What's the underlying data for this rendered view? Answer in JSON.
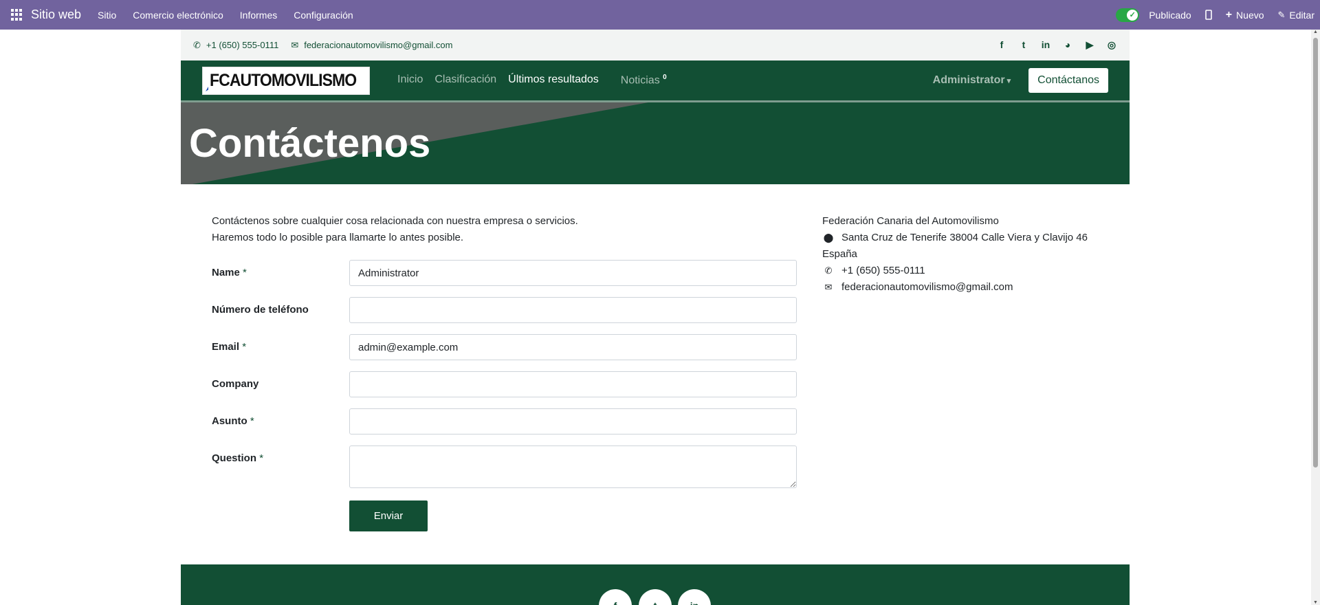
{
  "adminbar": {
    "brand": "Sitio web",
    "menu": [
      "Sitio",
      "Comercio electrónico",
      "Informes",
      "Configuración"
    ],
    "published_label": "Publicado",
    "new_label": "Nuevo",
    "edit_label": "Editar"
  },
  "topinfo": {
    "phone": "+1 (650) 555-0111",
    "email": "federacionautomovilismo@gmail.com",
    "social": [
      "facebook-icon",
      "twitter-icon",
      "linkedin-icon",
      "github-icon",
      "youtube-icon",
      "instagram-icon"
    ]
  },
  "navbar": {
    "logo_text": "FCAUTOMOVILISMO",
    "links": [
      "Inicio",
      "Clasificación",
      "Últimos resultados",
      "Noticias"
    ],
    "news_badge": "0",
    "user": "Administrator",
    "contact_button": "Contáctanos"
  },
  "banner": {
    "title": "Contáctenos"
  },
  "intro": {
    "line1": "Contáctenos sobre cualquier cosa relacionada con nuestra empresa o servicios.",
    "line2": "Haremos todo lo posible para llamarte lo antes posible."
  },
  "form": {
    "name_label": "Name",
    "name_value": "Administrator",
    "phone_label": "Número de teléfono",
    "phone_value": "",
    "email_label": "Email",
    "email_value": "admin@example.com",
    "company_label": "Company",
    "company_value": "",
    "subject_label": "Asunto",
    "subject_value": "",
    "question_label": "Question",
    "required_mark": "*",
    "submit_label": "Enviar"
  },
  "address": {
    "company": "Federación Canaria del Automovilismo",
    "street": "Santa Cruz de Tenerife 38004 Calle Viera y Clavijo 46",
    "country": "España",
    "phone": "+1 (650) 555-0111",
    "email": "federacionautomovilismo@gmail.com"
  },
  "colors": {
    "admin_bar": "#71639e",
    "brand_green": "#124f34",
    "toggle_green": "#28a745"
  }
}
